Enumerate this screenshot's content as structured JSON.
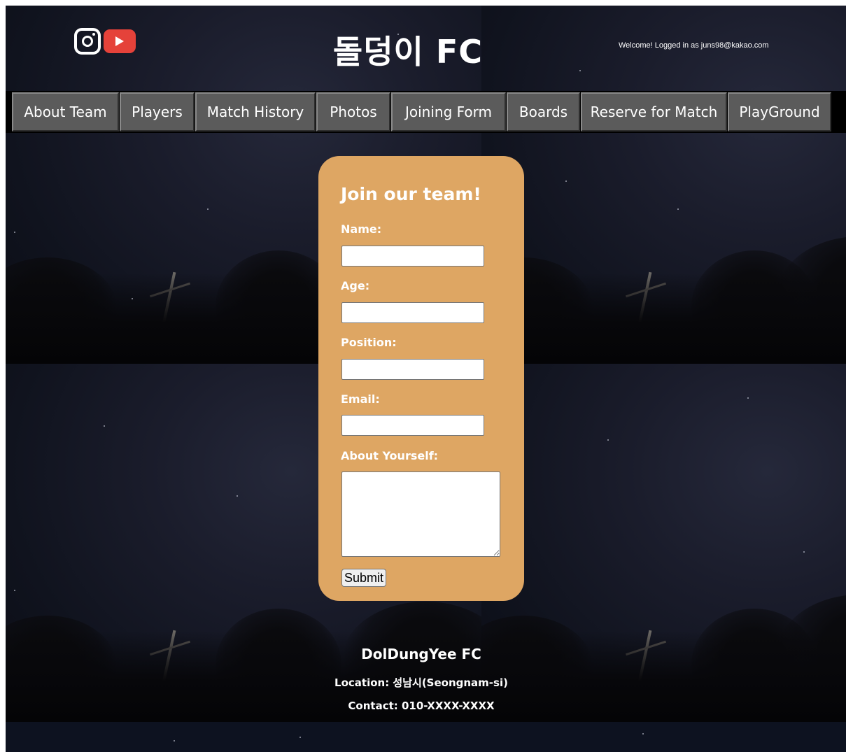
{
  "header": {
    "title": "돌덩이 FC",
    "welcome": "Welcome! Logged in as juns98@kakao.com",
    "social": [
      {
        "name": "instagram-icon"
      },
      {
        "name": "youtube-icon"
      }
    ]
  },
  "nav": {
    "items": [
      {
        "label": "About Team"
      },
      {
        "label": "Players"
      },
      {
        "label": "Match History"
      },
      {
        "label": "Photos"
      },
      {
        "label": "Joining Form"
      },
      {
        "label": "Boards"
      },
      {
        "label": "Reserve for Match"
      },
      {
        "label": "PlayGround"
      }
    ]
  },
  "form": {
    "heading": "Join our team!",
    "name_label": "Name:",
    "name_value": "",
    "age_label": "Age:",
    "age_value": "",
    "position_label": "Position:",
    "position_value": "",
    "email_label": "Email:",
    "email_value": "",
    "about_label": "About Yourself:",
    "about_value": "",
    "submit_label": "Submit"
  },
  "footer": {
    "name": "DolDungYee FC",
    "location": "Location: 성남시(Seongnam-si)",
    "contact": "Contact: 010-XXXX-XXXX"
  },
  "colors": {
    "card": "#dea663",
    "nav_item": "#5b5b5b",
    "nav_bar": "#000000",
    "youtube": "#e5423a"
  }
}
